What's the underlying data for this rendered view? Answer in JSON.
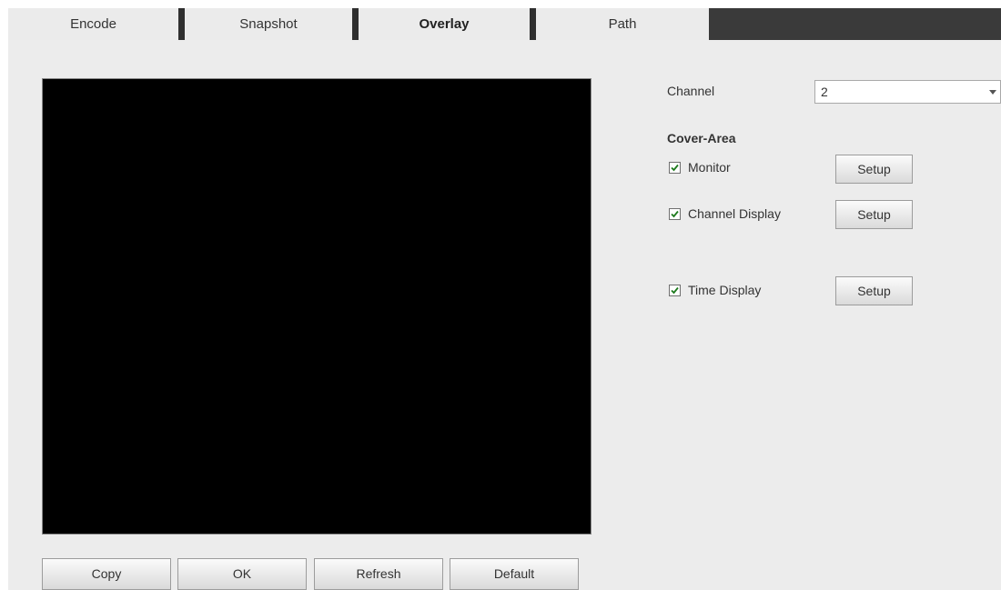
{
  "tabs": [
    {
      "label": "Encode",
      "active": false
    },
    {
      "label": "Snapshot",
      "active": false
    },
    {
      "label": "Overlay",
      "active": true
    },
    {
      "label": "Path",
      "active": false
    }
  ],
  "channel": {
    "label": "Channel",
    "value": "2"
  },
  "cover_area": {
    "title": "Cover-Area",
    "options": [
      {
        "label": "Monitor",
        "checked": true,
        "setup_label": "Setup"
      },
      {
        "label": "Channel Display",
        "checked": true,
        "setup_label": "Setup"
      },
      {
        "label": "Time Display",
        "checked": true,
        "setup_label": "Setup"
      }
    ]
  },
  "actions": {
    "copy": "Copy",
    "ok": "OK",
    "refresh": "Refresh",
    "default": "Default"
  },
  "colors": {
    "check_mark": "#1d7a1d",
    "tab_separator": "#2f2f2f",
    "video_background": "#000000"
  }
}
